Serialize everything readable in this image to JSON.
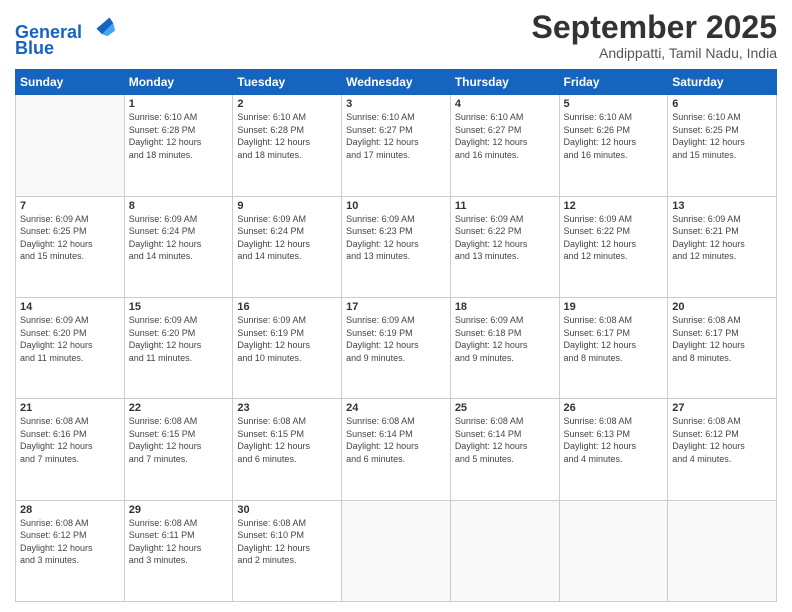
{
  "logo": {
    "line1": "General",
    "line2": "Blue"
  },
  "title": "September 2025",
  "location": "Andippatti, Tamil Nadu, India",
  "days_header": [
    "Sunday",
    "Monday",
    "Tuesday",
    "Wednesday",
    "Thursday",
    "Friday",
    "Saturday"
  ],
  "weeks": [
    [
      {
        "day": "",
        "info": ""
      },
      {
        "day": "1",
        "info": "Sunrise: 6:10 AM\nSunset: 6:28 PM\nDaylight: 12 hours\nand 18 minutes."
      },
      {
        "day": "2",
        "info": "Sunrise: 6:10 AM\nSunset: 6:28 PM\nDaylight: 12 hours\nand 18 minutes."
      },
      {
        "day": "3",
        "info": "Sunrise: 6:10 AM\nSunset: 6:27 PM\nDaylight: 12 hours\nand 17 minutes."
      },
      {
        "day": "4",
        "info": "Sunrise: 6:10 AM\nSunset: 6:27 PM\nDaylight: 12 hours\nand 16 minutes."
      },
      {
        "day": "5",
        "info": "Sunrise: 6:10 AM\nSunset: 6:26 PM\nDaylight: 12 hours\nand 16 minutes."
      },
      {
        "day": "6",
        "info": "Sunrise: 6:10 AM\nSunset: 6:25 PM\nDaylight: 12 hours\nand 15 minutes."
      }
    ],
    [
      {
        "day": "7",
        "info": "Sunrise: 6:09 AM\nSunset: 6:25 PM\nDaylight: 12 hours\nand 15 minutes."
      },
      {
        "day": "8",
        "info": "Sunrise: 6:09 AM\nSunset: 6:24 PM\nDaylight: 12 hours\nand 14 minutes."
      },
      {
        "day": "9",
        "info": "Sunrise: 6:09 AM\nSunset: 6:24 PM\nDaylight: 12 hours\nand 14 minutes."
      },
      {
        "day": "10",
        "info": "Sunrise: 6:09 AM\nSunset: 6:23 PM\nDaylight: 12 hours\nand 13 minutes."
      },
      {
        "day": "11",
        "info": "Sunrise: 6:09 AM\nSunset: 6:22 PM\nDaylight: 12 hours\nand 13 minutes."
      },
      {
        "day": "12",
        "info": "Sunrise: 6:09 AM\nSunset: 6:22 PM\nDaylight: 12 hours\nand 12 minutes."
      },
      {
        "day": "13",
        "info": "Sunrise: 6:09 AM\nSunset: 6:21 PM\nDaylight: 12 hours\nand 12 minutes."
      }
    ],
    [
      {
        "day": "14",
        "info": "Sunrise: 6:09 AM\nSunset: 6:20 PM\nDaylight: 12 hours\nand 11 minutes."
      },
      {
        "day": "15",
        "info": "Sunrise: 6:09 AM\nSunset: 6:20 PM\nDaylight: 12 hours\nand 11 minutes."
      },
      {
        "day": "16",
        "info": "Sunrise: 6:09 AM\nSunset: 6:19 PM\nDaylight: 12 hours\nand 10 minutes."
      },
      {
        "day": "17",
        "info": "Sunrise: 6:09 AM\nSunset: 6:19 PM\nDaylight: 12 hours\nand 9 minutes."
      },
      {
        "day": "18",
        "info": "Sunrise: 6:09 AM\nSunset: 6:18 PM\nDaylight: 12 hours\nand 9 minutes."
      },
      {
        "day": "19",
        "info": "Sunrise: 6:08 AM\nSunset: 6:17 PM\nDaylight: 12 hours\nand 8 minutes."
      },
      {
        "day": "20",
        "info": "Sunrise: 6:08 AM\nSunset: 6:17 PM\nDaylight: 12 hours\nand 8 minutes."
      }
    ],
    [
      {
        "day": "21",
        "info": "Sunrise: 6:08 AM\nSunset: 6:16 PM\nDaylight: 12 hours\nand 7 minutes."
      },
      {
        "day": "22",
        "info": "Sunrise: 6:08 AM\nSunset: 6:15 PM\nDaylight: 12 hours\nand 7 minutes."
      },
      {
        "day": "23",
        "info": "Sunrise: 6:08 AM\nSunset: 6:15 PM\nDaylight: 12 hours\nand 6 minutes."
      },
      {
        "day": "24",
        "info": "Sunrise: 6:08 AM\nSunset: 6:14 PM\nDaylight: 12 hours\nand 6 minutes."
      },
      {
        "day": "25",
        "info": "Sunrise: 6:08 AM\nSunset: 6:14 PM\nDaylight: 12 hours\nand 5 minutes."
      },
      {
        "day": "26",
        "info": "Sunrise: 6:08 AM\nSunset: 6:13 PM\nDaylight: 12 hours\nand 4 minutes."
      },
      {
        "day": "27",
        "info": "Sunrise: 6:08 AM\nSunset: 6:12 PM\nDaylight: 12 hours\nand 4 minutes."
      }
    ],
    [
      {
        "day": "28",
        "info": "Sunrise: 6:08 AM\nSunset: 6:12 PM\nDaylight: 12 hours\nand 3 minutes."
      },
      {
        "day": "29",
        "info": "Sunrise: 6:08 AM\nSunset: 6:11 PM\nDaylight: 12 hours\nand 3 minutes."
      },
      {
        "day": "30",
        "info": "Sunrise: 6:08 AM\nSunset: 6:10 PM\nDaylight: 12 hours\nand 2 minutes."
      },
      {
        "day": "",
        "info": ""
      },
      {
        "day": "",
        "info": ""
      },
      {
        "day": "",
        "info": ""
      },
      {
        "day": "",
        "info": ""
      }
    ]
  ]
}
